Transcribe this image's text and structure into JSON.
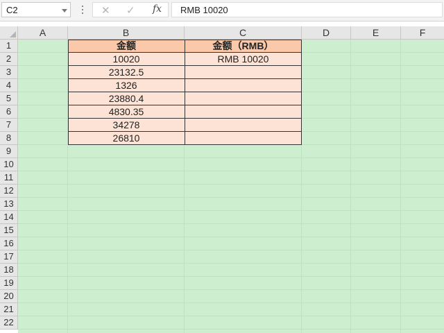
{
  "formula_bar": {
    "name_box": "C2",
    "cancel_icon": "✕",
    "enter_icon": "✓",
    "fx_label": "fx",
    "formula": "RMB 10020"
  },
  "columns": [
    "A",
    "B",
    "C",
    "D",
    "E",
    "F"
  ],
  "rows": [
    "1",
    "2",
    "3",
    "4",
    "5",
    "6",
    "7",
    "8",
    "9",
    "10",
    "11",
    "12",
    "13",
    "14",
    "15",
    "16",
    "17",
    "18",
    "19",
    "20",
    "21",
    "22"
  ],
  "table": {
    "header_b": "金额",
    "header_c": "金额（RMB）",
    "amounts": [
      "10020",
      "23132.5",
      "1326",
      "23880.4",
      "4830.35",
      "34278",
      "26810"
    ],
    "rmb": [
      "RMB 10020",
      "",
      "",
      "",
      "",
      "",
      ""
    ]
  },
  "colors": {
    "sheet_background": "#cdeecf",
    "header_fill": "#fbc9a9",
    "data_fill": "#fde3d5"
  }
}
